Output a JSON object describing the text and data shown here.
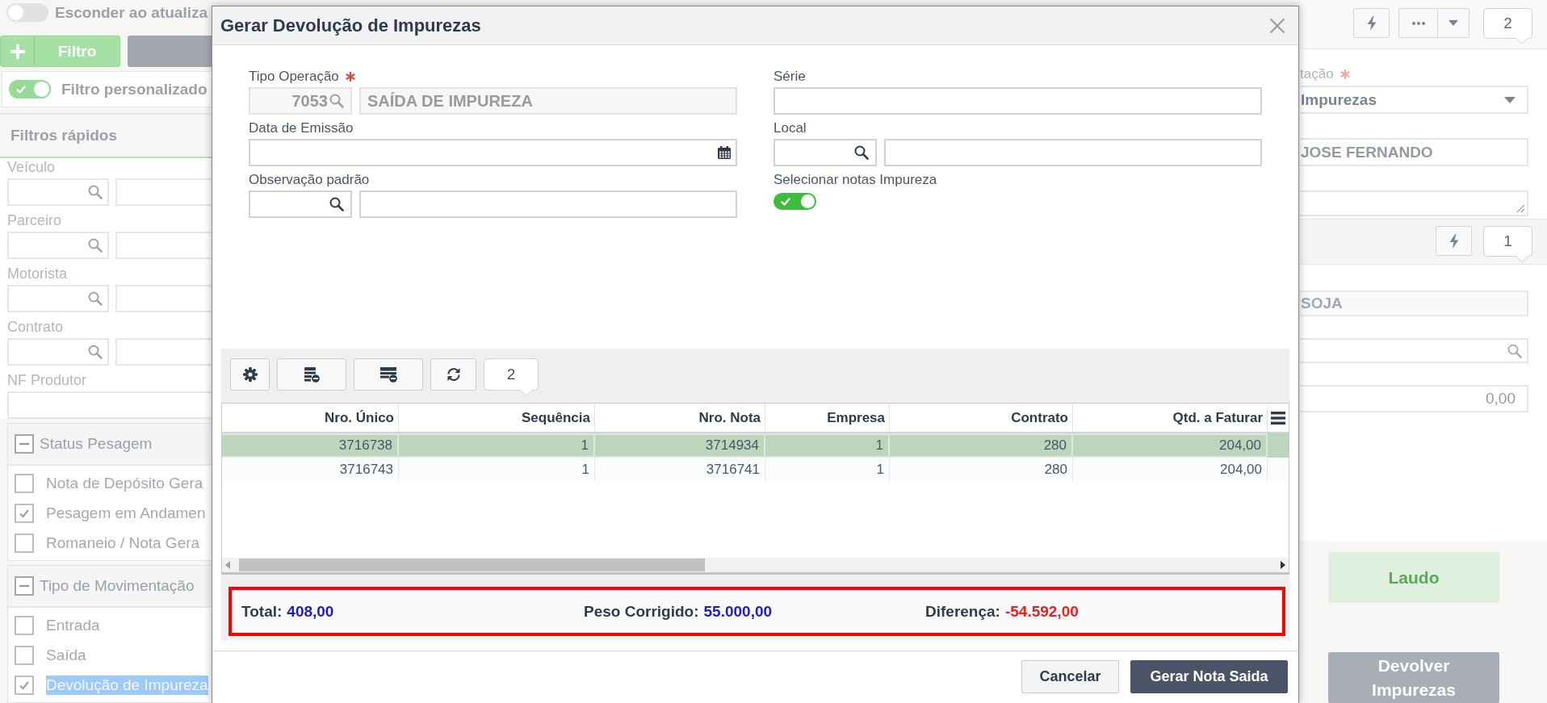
{
  "sidebar": {
    "hide_on_update": {
      "label": "Esconder ao atualiza",
      "on": false
    },
    "filter_button": {
      "label": "Filtro"
    },
    "custom_filter": {
      "label": "Filtro personalizado",
      "on": true
    },
    "quick_filters": {
      "title": "Filtros rápidos",
      "fields": [
        {
          "label": "Veículo",
          "kind": "lookup"
        },
        {
          "label": "Parceiro",
          "kind": "lookup"
        },
        {
          "label": "Motorista",
          "kind": "lookup"
        },
        {
          "label": "Contrato",
          "kind": "lookup"
        },
        {
          "label": "NF Produtor",
          "kind": "text"
        }
      ]
    },
    "groups": [
      {
        "title": "Status Pesagem",
        "expanded": true,
        "items": [
          {
            "label": "Nota de Depósito Gera",
            "checked": false,
            "highlighted": false
          },
          {
            "label": "Pesagem em Andamen",
            "checked": true,
            "highlighted": false
          },
          {
            "label": "Romaneio / Nota Gera",
            "checked": false,
            "highlighted": false
          }
        ]
      },
      {
        "title": "Tipo de Movimentação",
        "expanded": true,
        "items": [
          {
            "label": "Entrada",
            "checked": false,
            "highlighted": false
          },
          {
            "label": "Saída",
            "checked": false,
            "highlighted": false
          },
          {
            "label": "Devolução de Impureza",
            "checked": true,
            "highlighted": true
          }
        ]
      }
    ]
  },
  "dialog": {
    "title": "Gerar Devolução de Impurezas",
    "left_fields": [
      {
        "kind": "lookup",
        "label": "Tipo Operação",
        "required": true,
        "disabled": true,
        "code": "7053",
        "value": "SAÍDA DE IMPUREZA"
      },
      {
        "kind": "date",
        "label": "Data de Emissão",
        "required": false,
        "disabled": false
      },
      {
        "kind": "lookup",
        "label": "Observação padrão",
        "required": false,
        "disabled": false
      }
    ],
    "right_fields": [
      {
        "kind": "text",
        "label": "Série",
        "required": false,
        "disabled": false
      },
      {
        "kind": "lookup",
        "label": "Local",
        "required": false,
        "disabled": false
      },
      {
        "kind": "toggle",
        "label": "Selecionar notas Impureza",
        "required": false,
        "disabled": false,
        "on": true
      }
    ],
    "grid": {
      "record_count": "2",
      "columns": [
        "Nro. Único",
        "Sequência",
        "Nro. Nota",
        "Empresa",
        "Contrato",
        "Qtd. a Faturar"
      ],
      "rows": [
        {
          "selected": true,
          "cells": [
            "3716738",
            "1",
            "3714934",
            "1",
            "280",
            "204,00"
          ]
        },
        {
          "selected": false,
          "cells": [
            "3716743",
            "1",
            "3716741",
            "1",
            "280",
            "204,00"
          ]
        }
      ]
    },
    "summary": [
      {
        "label": "Total:",
        "value": "408,00",
        "color": "#1a1ad6"
      },
      {
        "label": "Peso Corrigido:",
        "value": "55.000,00",
        "color": "#1a1ad6"
      },
      {
        "label": "Diferença:",
        "value": "-54.592,00",
        "color": "#f41c1c"
      }
    ],
    "buttons": [
      {
        "label": "Cancelar",
        "kind": "secondary"
      },
      {
        "label": "Gerar Nota Saida",
        "kind": "primary"
      }
    ]
  },
  "detail_panel": {
    "toolbar": {
      "record_count": "2"
    },
    "fields": [
      {
        "kind": "select",
        "label": "tação",
        "required": true,
        "value": "Impurezas"
      },
      {
        "kind": "text",
        "required": false,
        "value": "JOSE FERNANDO"
      },
      {
        "kind": "textarea",
        "required": false
      }
    ],
    "sub_toolbar": {
      "record_count": "1"
    },
    "sub_fields": [
      {
        "kind": "text",
        "value": "SOJA",
        "disabled": true
      },
      {
        "kind": "lookup",
        "disabled": false
      },
      {
        "kind": "number",
        "value": "0,00",
        "disabled": false
      }
    ],
    "buttons": [
      {
        "label": "Laudo",
        "disabled": true
      },
      {
        "label": "Devolver Impurezas",
        "disabled": false
      }
    ]
  }
}
